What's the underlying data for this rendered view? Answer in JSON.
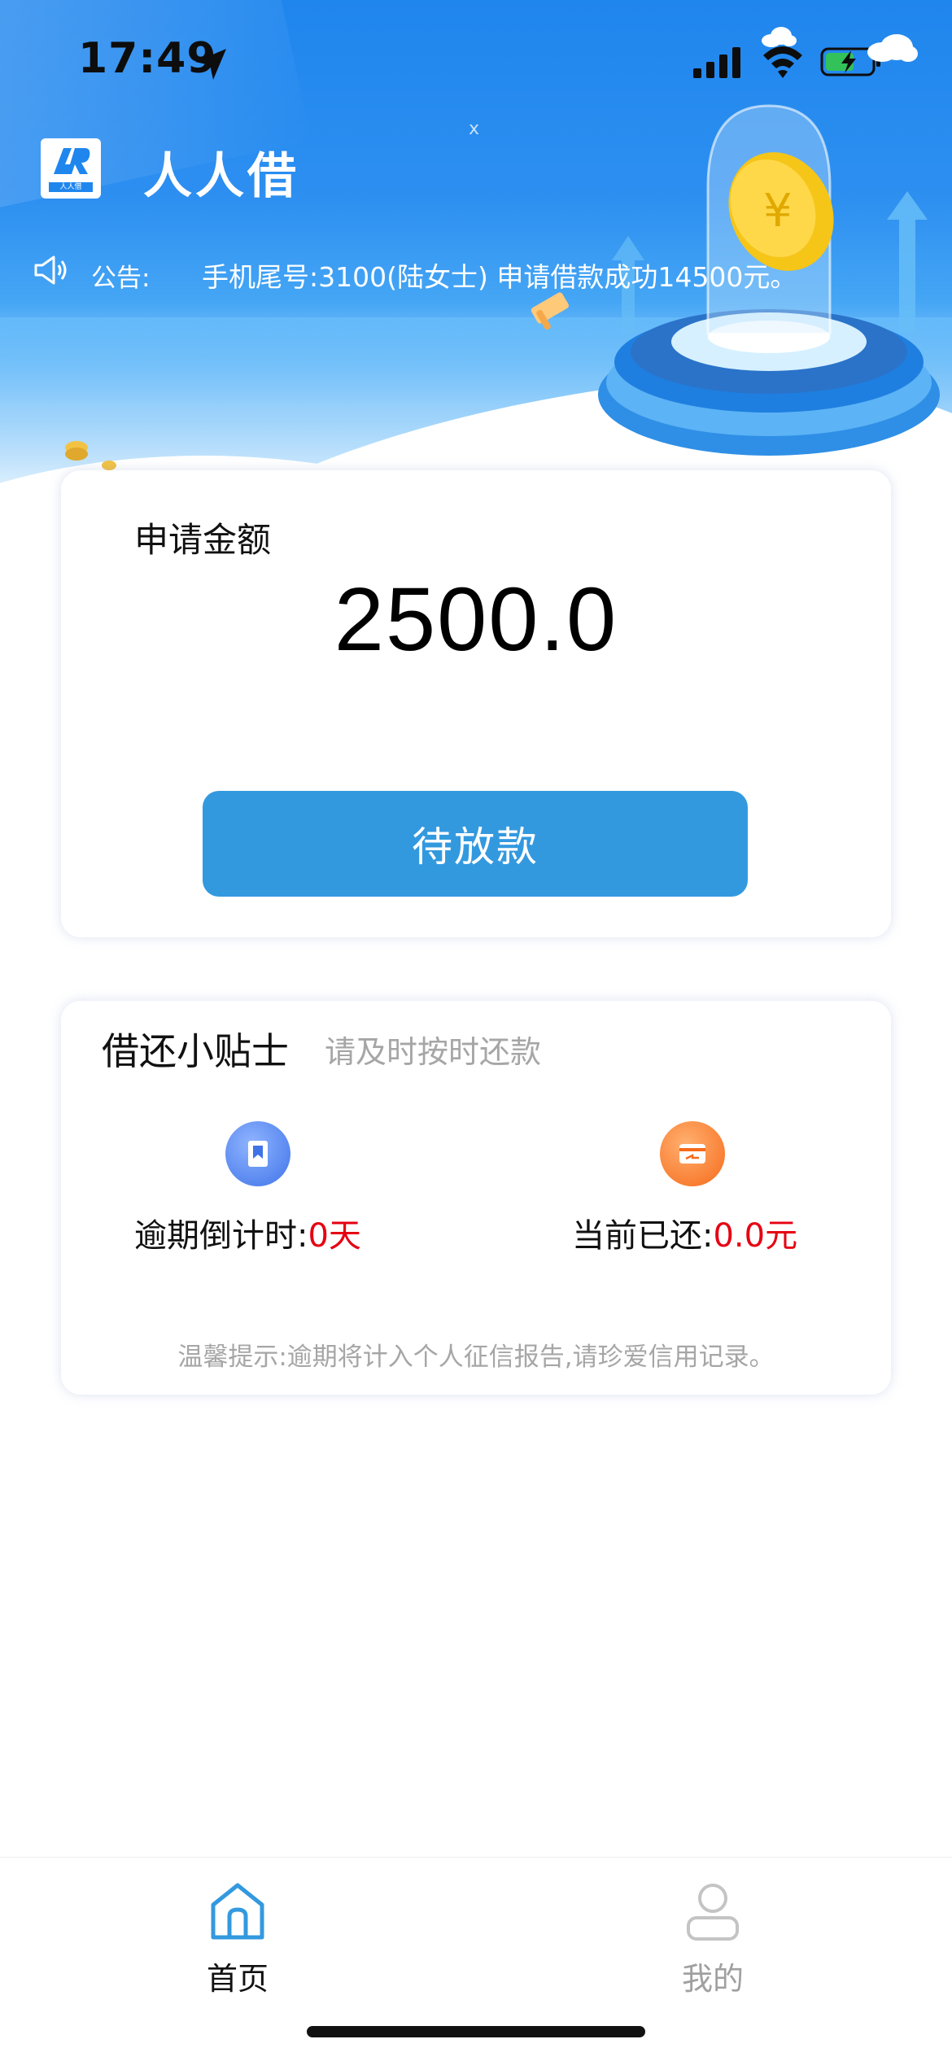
{
  "status_bar": {
    "time": "17:49"
  },
  "header": {
    "app_title": "人人借",
    "logo_sub": "人人借",
    "close_label": "x"
  },
  "notice": {
    "label": "公告:",
    "text": "手机尾号:3100(陆女士) 申请借款成功14500元。"
  },
  "amount_card": {
    "label": "申请金额",
    "amount": "2500.0",
    "status_button": "待放款"
  },
  "tips": {
    "title": "借还小贴士",
    "subtitle": "请及时按时还款",
    "overdue_label": "逾期倒计时:",
    "overdue_value": "0天",
    "repaid_label": "当前已还:",
    "repaid_value": "0.0元",
    "note": "温馨提示:逾期将计入个人征信报告,请珍爱信用记录。"
  },
  "tabbar": {
    "home": "首页",
    "mine": "我的"
  },
  "colors": {
    "primary_blue": "#1f86ee",
    "button_blue": "#3399df",
    "alert_red": "#e60012",
    "muted_gray": "#a6a6a6"
  },
  "icons": {
    "status": [
      "location-arrow-icon",
      "cellular-signal-icon",
      "wifi-icon",
      "battery-charging-icon"
    ],
    "notice": "megaphone-icon",
    "tips": [
      "bookmark-icon",
      "card-icon"
    ],
    "tabs": [
      "home-icon",
      "person-icon"
    ]
  }
}
